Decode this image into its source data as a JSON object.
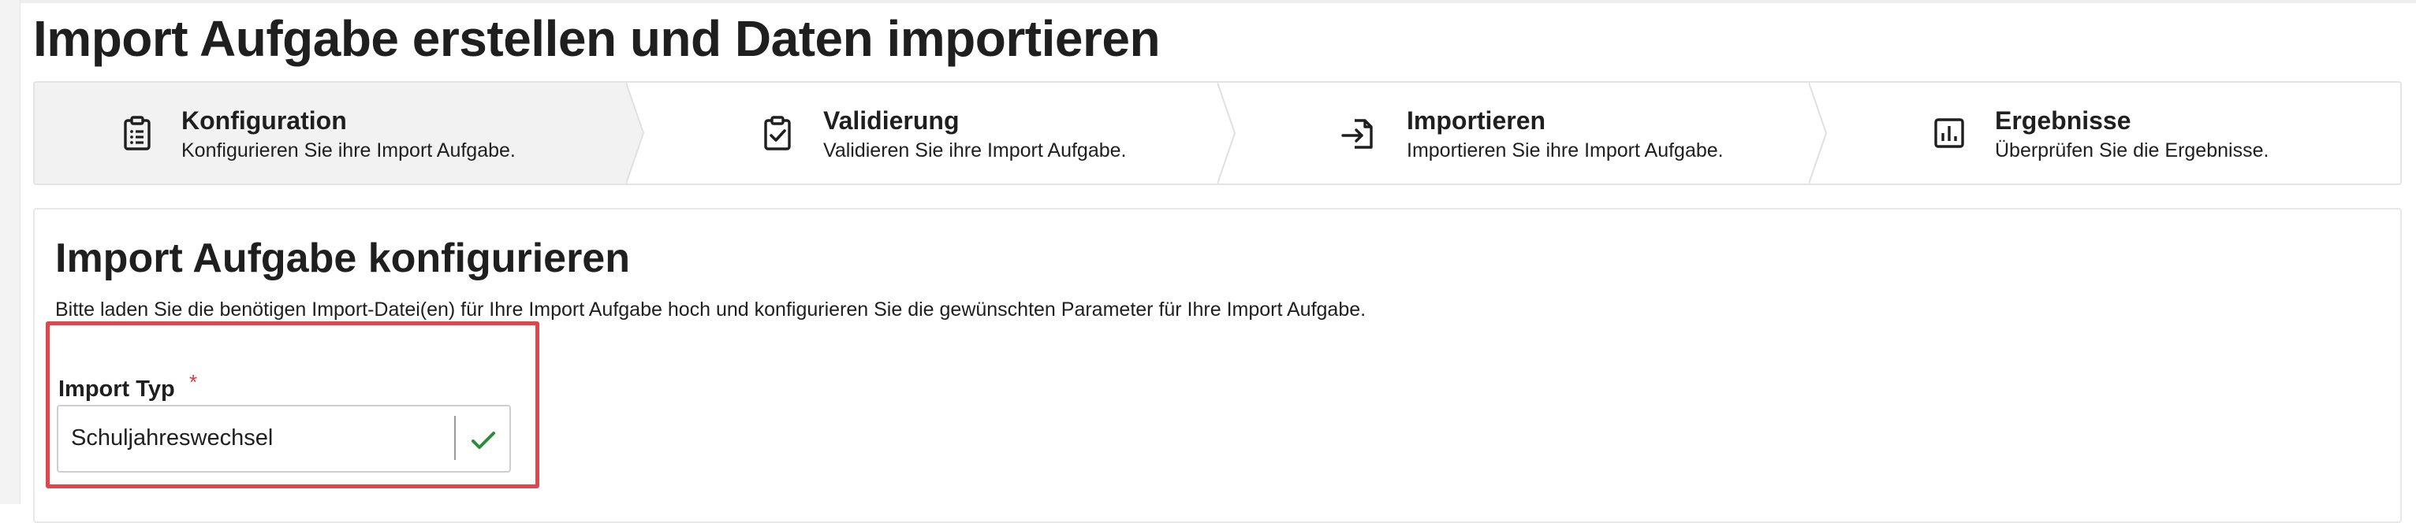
{
  "page": {
    "title": "Import Aufgabe erstellen und Daten importieren"
  },
  "stepper": {
    "steps": [
      {
        "title": "Konfiguration",
        "description": "Konfigurieren Sie ihre Import Aufgabe.",
        "icon": "clipboard-list-icon",
        "active": true
      },
      {
        "title": "Validierung",
        "description": "Validieren Sie ihre Import Aufgabe.",
        "icon": "clipboard-check-icon",
        "active": false
      },
      {
        "title": "Importieren",
        "description": "Importieren Sie ihre Import Aufgabe.",
        "icon": "file-import-icon",
        "active": false
      },
      {
        "title": "Ergebnisse",
        "description": "Überprüfen Sie die Ergebnisse.",
        "icon": "bar-chart-icon",
        "active": false
      }
    ]
  },
  "config": {
    "title": "Import Aufgabe konfigurieren",
    "description": "Bitte laden Sie die benötigen Import-Datei(en) für Ihre Import Aufgabe hoch und konfigurieren Sie die gewünschten Parameter für Ihre Import Aufgabe.",
    "import_type": {
      "label": "Import Typ",
      "required_marker": "*",
      "value": "Schuljahreswechsel"
    }
  },
  "colors": {
    "highlight": "#e0464c",
    "active_step_bg": "#f2f2f2",
    "check": "#2e8b3a",
    "required": "#d9363e"
  }
}
